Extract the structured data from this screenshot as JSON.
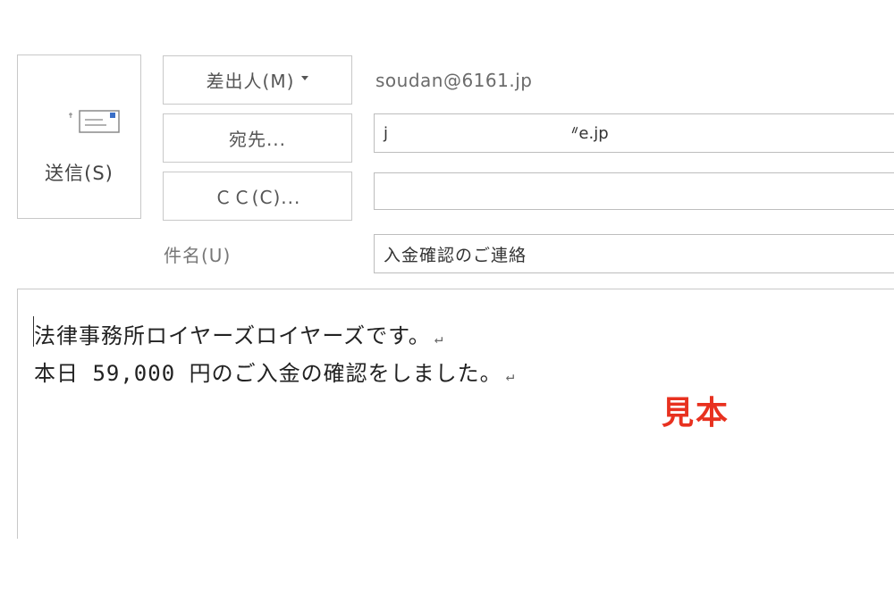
{
  "send": {
    "label": "送信(S)",
    "icon": "send-mail-icon"
  },
  "header": {
    "from_button": "差出人(M)",
    "to_button": "宛先...",
    "cc_button": "ＣＣ(C)...",
    "from_address": "soudan@6161.jp",
    "to_value_start": "j",
    "to_value_end": "ᐥe.jp",
    "cc_value": "",
    "subject_label": "件名(U)",
    "subject_value": "入金確認のご連絡"
  },
  "body": {
    "line1": "法律事務所ロイヤーズロイヤーズです。",
    "line2": "本日 59,000 円のご入金の確認をしました。",
    "return_mark": "↵"
  },
  "watermark": {
    "text": "見本",
    "color": "#e8311f"
  }
}
